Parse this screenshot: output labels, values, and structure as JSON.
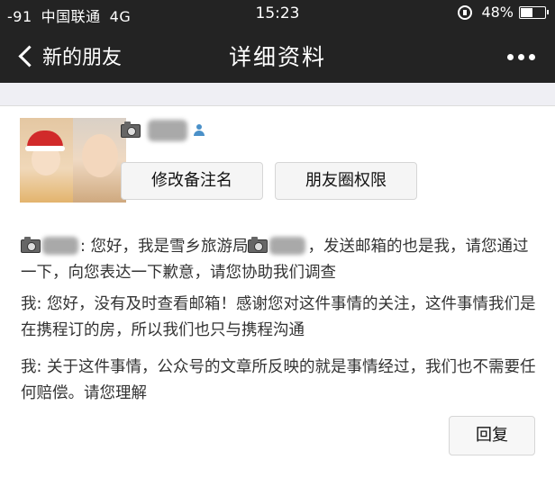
{
  "status_bar": {
    "signal": "-91",
    "carrier": "中国联通",
    "network": "4G",
    "time": "15:23",
    "battery": "48%"
  },
  "nav": {
    "back_label": "新的朋友",
    "title": "详细资料"
  },
  "profile": {
    "remark_button": "修改备注名",
    "moments_button": "朋友圈权限"
  },
  "messages": {
    "msg1_part1": ": 您好，我是雪乡旅游局",
    "msg1_part2": "，发送邮箱的也是我，请您通过一下，向您表达一下歉意，请您协助我们调查",
    "msg2": "我: 您好，没有及时查看邮箱！感谢您对这件事情的关注，这件事情我们是在携程订的房，所以我们也只与携程沟通",
    "msg3": "我: 关于这件事情，公众号的文章所反映的就是事情经过，我们也不需要任何赔偿。请您理解"
  },
  "reply_button": "回复"
}
